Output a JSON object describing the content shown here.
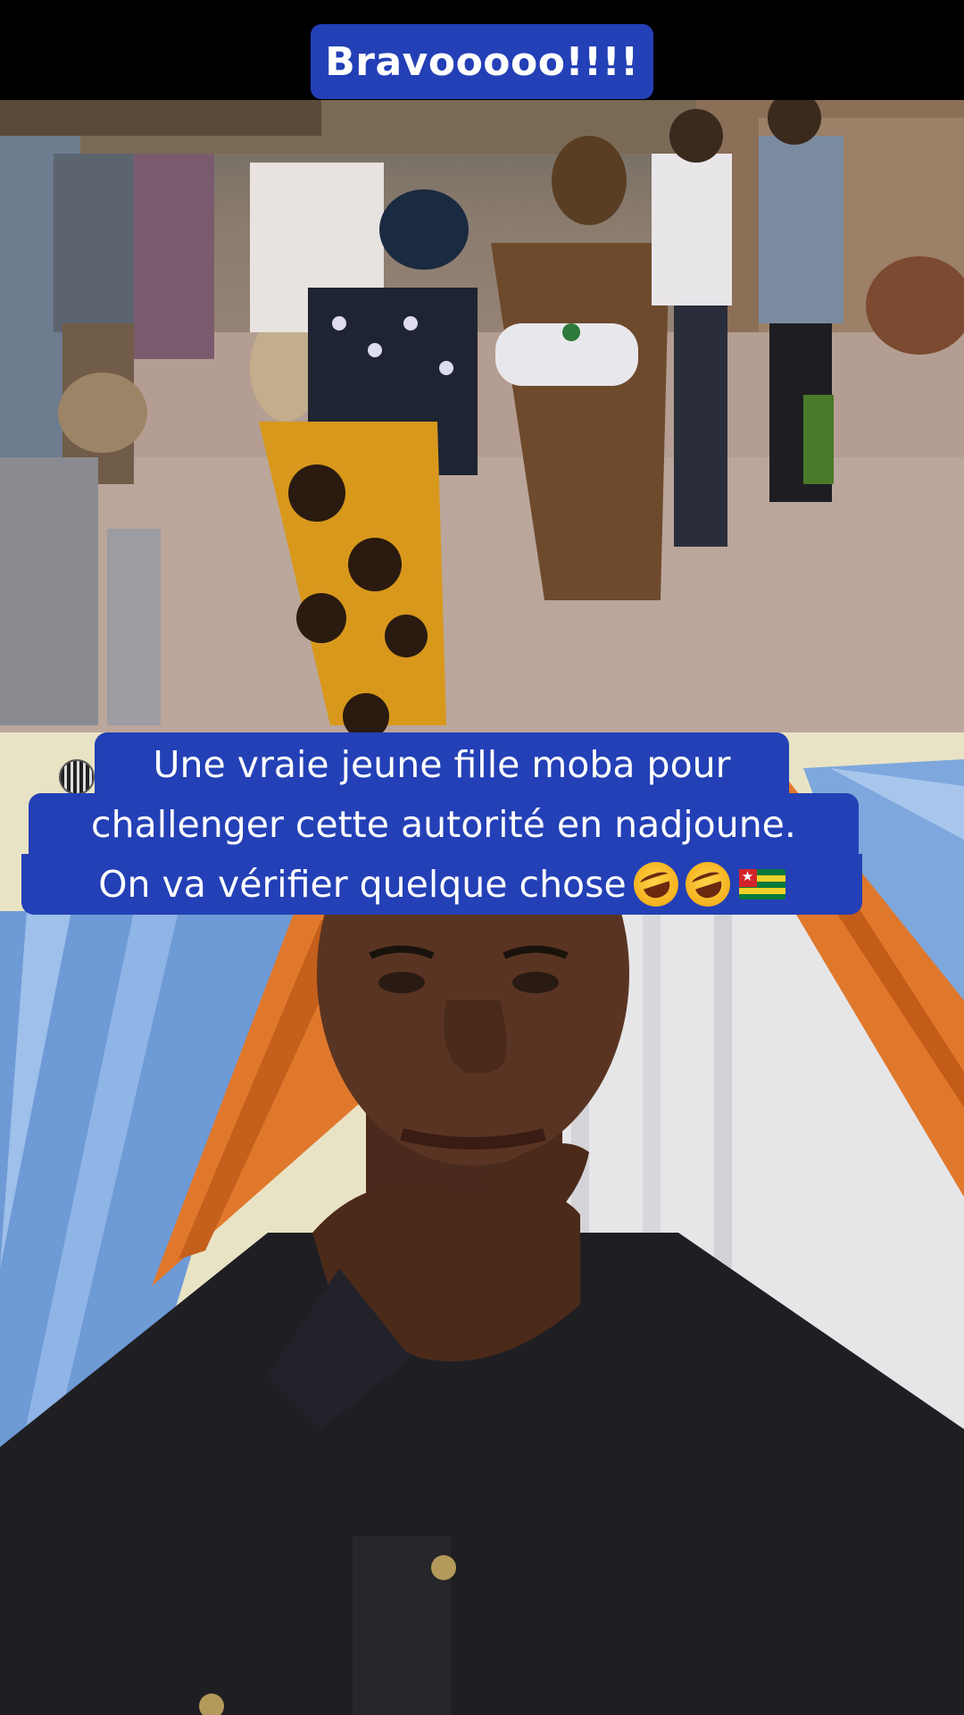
{
  "captions": {
    "top": "Bravooooo!!!!",
    "line1": "Une vraie jeune fille moba pour",
    "line2": "challenger cette autorité en nadjoune.",
    "line3": "On va vérifier quelque chose"
  },
  "emoji": [
    "rolling-on-floor-laughing",
    "rolling-on-floor-laughing",
    "togo-flag"
  ],
  "colors": {
    "caption_bg": "#2340b6",
    "caption_text": "#ffffff"
  }
}
